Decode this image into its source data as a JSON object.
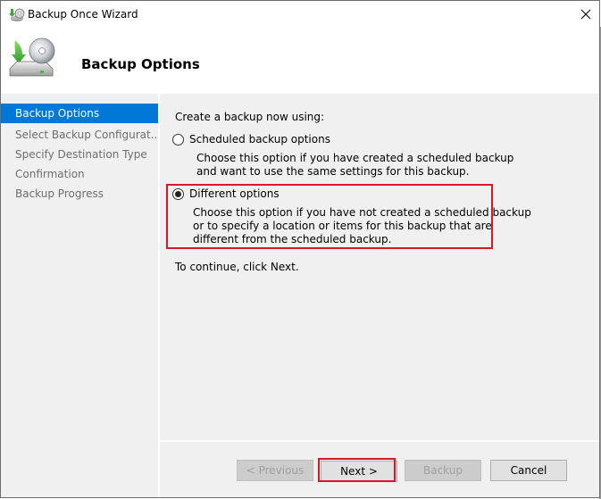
{
  "window": {
    "title": "Backup Once Wizard",
    "close_label": "×",
    "icons": {
      "title": "backup-wizard-icon",
      "header": "backup-drive-icon",
      "close": "close-icon"
    }
  },
  "header": {
    "title": "Backup Options"
  },
  "sidebar": {
    "items": [
      {
        "label": "Backup Options",
        "active": true
      },
      {
        "label": "Select Backup Configurat...",
        "active": false
      },
      {
        "label": "Specify Destination Type",
        "active": false
      },
      {
        "label": "Confirmation",
        "active": false
      },
      {
        "label": "Backup Progress",
        "active": false
      }
    ],
    "active_color": "#0078d7"
  },
  "content": {
    "intro": "Create a backup now using:",
    "options": [
      {
        "label": "Scheduled backup options",
        "selected": false,
        "description_lines": [
          "Choose this option if you have created a scheduled backup",
          "and want to use the same settings for this backup."
        ]
      },
      {
        "label": "Different options",
        "selected": true,
        "description_lines": [
          "Choose this option if you have not created a scheduled backup",
          "or to specify a location or items for this backup that are",
          "different from the scheduled backup."
        ]
      }
    ],
    "continue_hint": "To continue, click Next.",
    "highlight_color": "#d7182a"
  },
  "buttons": {
    "previous": {
      "label": "< Previous",
      "enabled": false
    },
    "next": {
      "label": "Next >",
      "enabled": true
    },
    "backup": {
      "label": "Backup",
      "enabled": false
    },
    "cancel": {
      "label": "Cancel",
      "enabled": true
    }
  }
}
